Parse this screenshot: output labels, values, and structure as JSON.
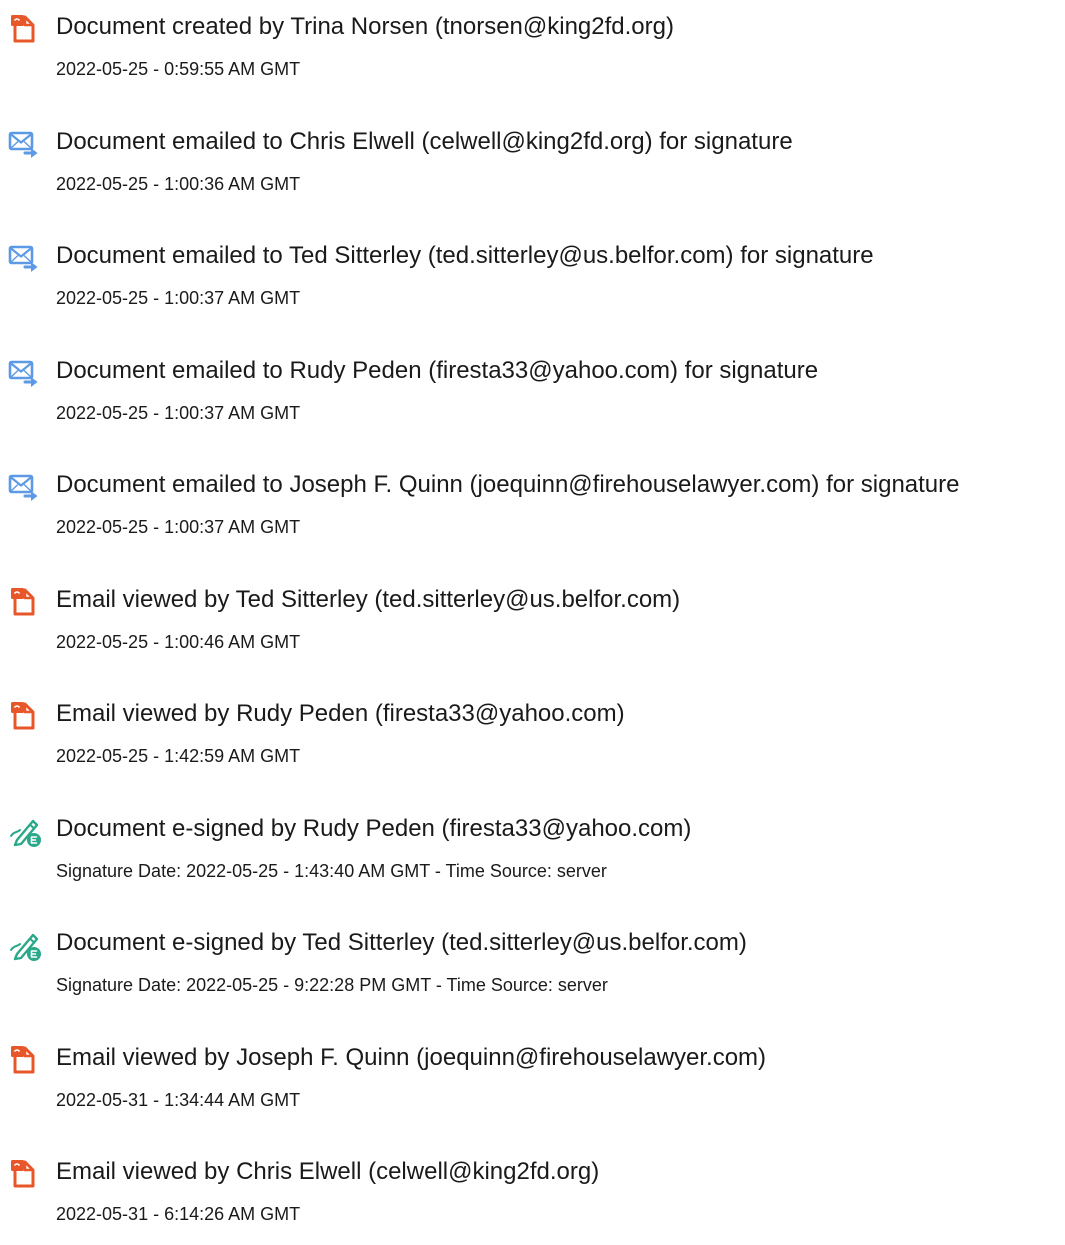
{
  "colors": {
    "document_icon": "#e8572a",
    "email_icon": "#5c9ae6",
    "esign_icon": "#2aa889"
  },
  "events": [
    {
      "icon": "document-icon",
      "title": "Document created by Trina Norsen (tnorsen@king2fd.org)",
      "detail": "2022-05-25 - 0:59:55 AM GMT"
    },
    {
      "icon": "email-sent-icon",
      "title": "Document emailed to Chris Elwell (celwell@king2fd.org) for signature",
      "detail": "2022-05-25 - 1:00:36 AM GMT"
    },
    {
      "icon": "email-sent-icon",
      "title": "Document emailed to Ted Sitterley (ted.sitterley@us.belfor.com) for signature",
      "detail": "2022-05-25 - 1:00:37 AM GMT"
    },
    {
      "icon": "email-sent-icon",
      "title": "Document emailed to Rudy Peden (firesta33@yahoo.com) for signature",
      "detail": "2022-05-25 - 1:00:37 AM GMT"
    },
    {
      "icon": "email-sent-icon",
      "title": "Document emailed to Joseph F. Quinn (joequinn@firehouselawyer.com) for signature",
      "detail": "2022-05-25 - 1:00:37 AM GMT"
    },
    {
      "icon": "document-icon",
      "title": "Email viewed by Ted Sitterley (ted.sitterley@us.belfor.com)",
      "detail": "2022-05-25 - 1:00:46 AM GMT"
    },
    {
      "icon": "document-icon",
      "title": "Email viewed by Rudy Peden (firesta33@yahoo.com)",
      "detail": "2022-05-25 - 1:42:59 AM GMT"
    },
    {
      "icon": "esign-pen-icon",
      "title": "Document e-signed by Rudy Peden (firesta33@yahoo.com)",
      "detail": "Signature Date: 2022-05-25 - 1:43:40 AM GMT - Time Source: server"
    },
    {
      "icon": "esign-pen-icon",
      "title": "Document e-signed by Ted Sitterley (ted.sitterley@us.belfor.com)",
      "detail": "Signature Date: 2022-05-25 - 9:22:28 PM GMT - Time Source: server"
    },
    {
      "icon": "document-icon",
      "title": "Email viewed by Joseph F. Quinn (joequinn@firehouselawyer.com)",
      "detail": "2022-05-31 - 1:34:44 AM GMT"
    },
    {
      "icon": "document-icon",
      "title": "Email viewed by Chris Elwell (celwell@king2fd.org)",
      "detail": "2022-05-31 - 6:14:26 AM GMT"
    }
  ]
}
